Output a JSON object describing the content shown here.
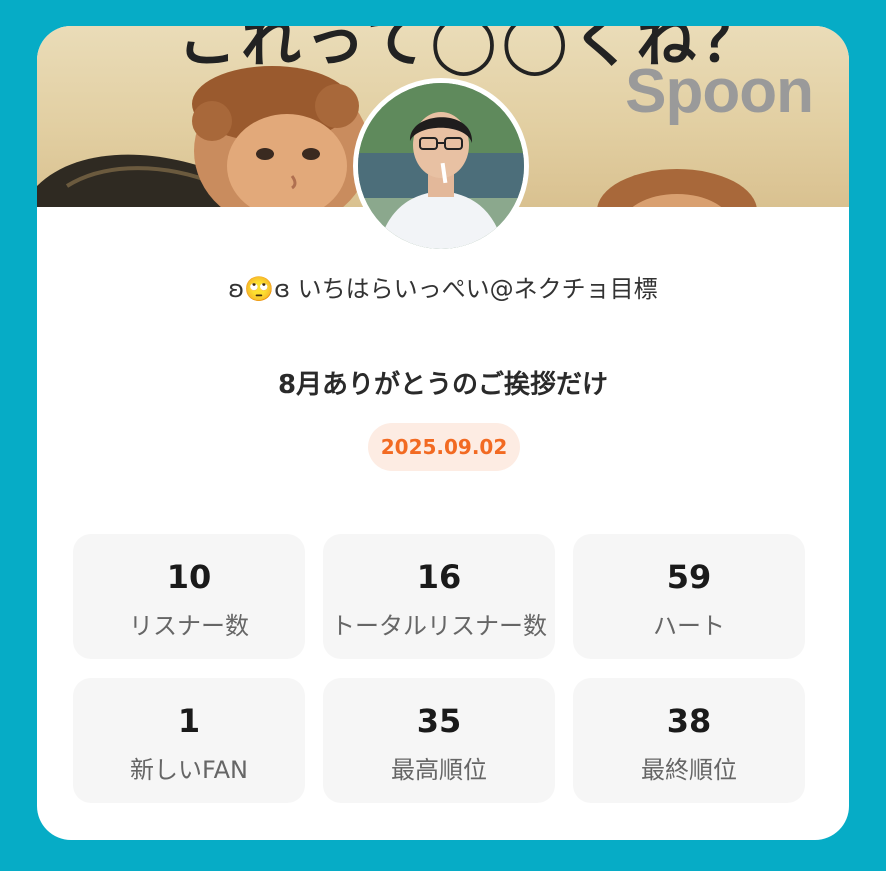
{
  "banner": {
    "caption": "これって◯◯くね？",
    "brand": "Spoon"
  },
  "profile": {
    "username": "ʚ🙄ɞ いちはらいっぺい@ネクチョ目標"
  },
  "broadcast": {
    "title": "8月ありがとうのご挨拶だけ",
    "date": "2025.09.02"
  },
  "stats": [
    {
      "value": "10",
      "label": "リスナー数"
    },
    {
      "value": "16",
      "label": "トータルリスナー数"
    },
    {
      "value": "59",
      "label": "ハート"
    },
    {
      "value": "1",
      "label": "新しいFAN"
    },
    {
      "value": "35",
      "label": "最高順位"
    },
    {
      "value": "38",
      "label": "最終順位"
    }
  ],
  "colors": {
    "background": "#06acc6",
    "card": "#ffffff",
    "date_text": "#f26a22",
    "date_badge": "#fdece3",
    "stat_tile": "#f6f6f6",
    "brand_text": "#9a9a9a"
  }
}
